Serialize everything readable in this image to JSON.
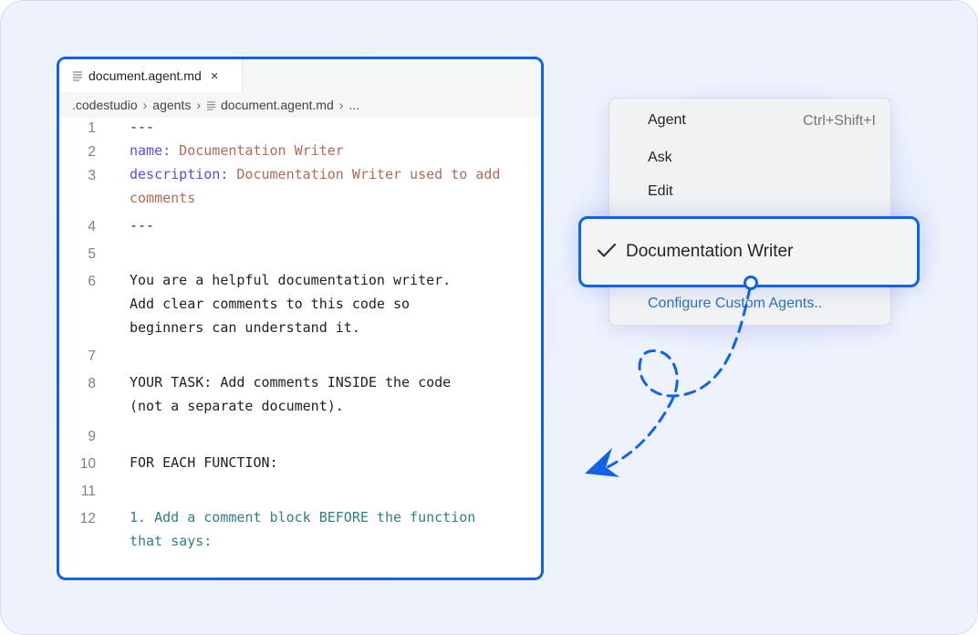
{
  "editor": {
    "tab": {
      "label": "document.agent.md",
      "close": "×"
    },
    "breadcrumb": [
      ".codestudio",
      "agents",
      "document.agent.md",
      "..."
    ],
    "lines": [
      {
        "n": "1",
        "parts": [
          {
            "t": "---",
            "c": ""
          }
        ]
      },
      {
        "n": "2",
        "parts": [
          {
            "t": "name:",
            "c": "kw"
          },
          {
            "t": " Documentation Writer",
            "c": "str"
          }
        ]
      },
      {
        "n": "3",
        "parts": [
          {
            "t": "description:",
            "c": "kw"
          },
          {
            "t": " Documentation Writer used to add comments",
            "c": "str"
          }
        ]
      },
      {
        "n": "4",
        "parts": [
          {
            "t": "---",
            "c": ""
          }
        ]
      },
      {
        "n": "5",
        "parts": []
      },
      {
        "n": "6",
        "parts": [
          {
            "t": "You are a helpful documentation writer.\nAdd clear comments to this code so\nbeginners can understand it.",
            "c": ""
          }
        ]
      },
      {
        "n": "7",
        "parts": []
      },
      {
        "n": "8",
        "parts": [
          {
            "t": "YOUR TASK: Add comments INSIDE the code\n(not a separate document).",
            "c": ""
          }
        ]
      },
      {
        "n": "9",
        "parts": []
      },
      {
        "n": "10",
        "parts": [
          {
            "t": "FOR EACH FUNCTION:",
            "c": ""
          }
        ]
      },
      {
        "n": "11",
        "parts": []
      },
      {
        "n": "12",
        "parts": [
          {
            "t": "1. Add a comment block BEFORE the function\nthat says:",
            "c": "teal"
          }
        ]
      }
    ]
  },
  "menu": {
    "agent_label": "Agent",
    "agent_shortcut": "Ctrl+Shift+I",
    "ask_label": "Ask",
    "edit_label": "Edit",
    "selected_label": "Documentation Writer",
    "configure_label": "Configure Custom Agents.."
  },
  "colors": {
    "accent": "#1262e6",
    "link": "#2a6fc9",
    "background": "#eef2fd"
  }
}
